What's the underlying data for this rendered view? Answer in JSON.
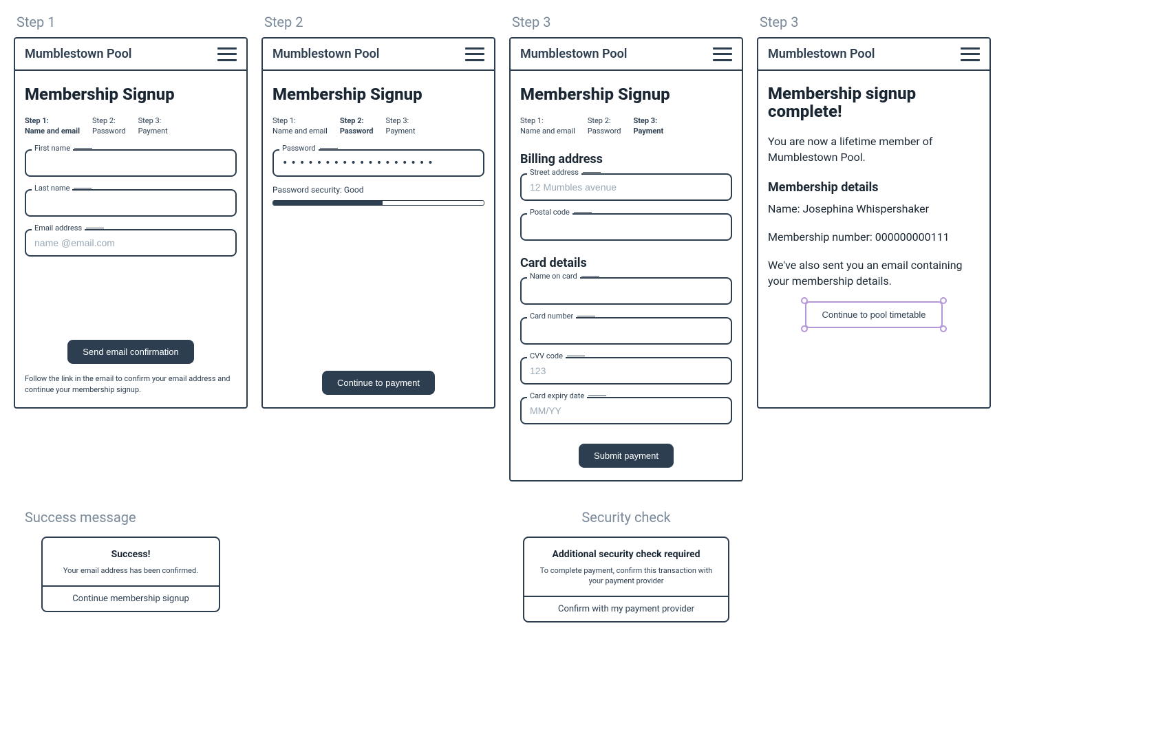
{
  "stepLabels": {
    "s1": "Step 1",
    "s2": "Step 2",
    "s3a": "Step 3",
    "s3b": "Step 3"
  },
  "app": {
    "title": "Mumblestown Pool"
  },
  "heading": "Membership Signup",
  "stepper": {
    "1": {
      "line1": "Step 1:",
      "line2": "Name and email"
    },
    "2": {
      "line1": "Step 2:",
      "line2": "Password"
    },
    "3": {
      "line1": "Step 3:",
      "line2": "Payment"
    }
  },
  "step1": {
    "firstNameLabel": "First name",
    "lastNameLabel": "Last name",
    "emailLabel": "Email address",
    "emailPlaceholder": "name @email.com",
    "button": "Send email confirmation",
    "helper": "Follow the link in the email to confirm your email address and continue your membership signup."
  },
  "step2": {
    "passwordLabel": "Password",
    "passwordValue": "••••••••••••••••••",
    "strengthText": "Password security: Good",
    "button": "Continue to payment"
  },
  "step3": {
    "billingTitle": "Billing address",
    "streetLabel": "Street address",
    "streetPlaceholder": "12 Mumbles avenue",
    "postalLabel": "Postal code",
    "cardTitle": "Card details",
    "nameOnCardLabel": "Name on card",
    "cardNumberLabel": "Card number",
    "cvvLabel": "CVV code",
    "cvvPlaceholder": "123",
    "expiryLabel": "Card expiry date",
    "expiryPlaceholder": "MM/YY",
    "button": "Submit payment"
  },
  "complete": {
    "heading": "Membership signup complete!",
    "intro": "You are now a lifetime member of Mumblestown Pool.",
    "detailsTitle": "Membership details",
    "nameLine": "Name: Josephina Whispershaker",
    "numberLine": "Membership number: 000000000111",
    "emailNote": "We've also sent you an email containing your membership details.",
    "button": "Continue to pool timetable"
  },
  "successMsg": {
    "label": "Success message",
    "title": "Success!",
    "text": "Your email address has been confirmed.",
    "action": "Continue membership signup"
  },
  "securityCheck": {
    "label": "Security check",
    "title": "Additional security check required",
    "text": "To complete payment, confirm this transaction with your payment provider",
    "action": "Confirm with my payment provider"
  }
}
